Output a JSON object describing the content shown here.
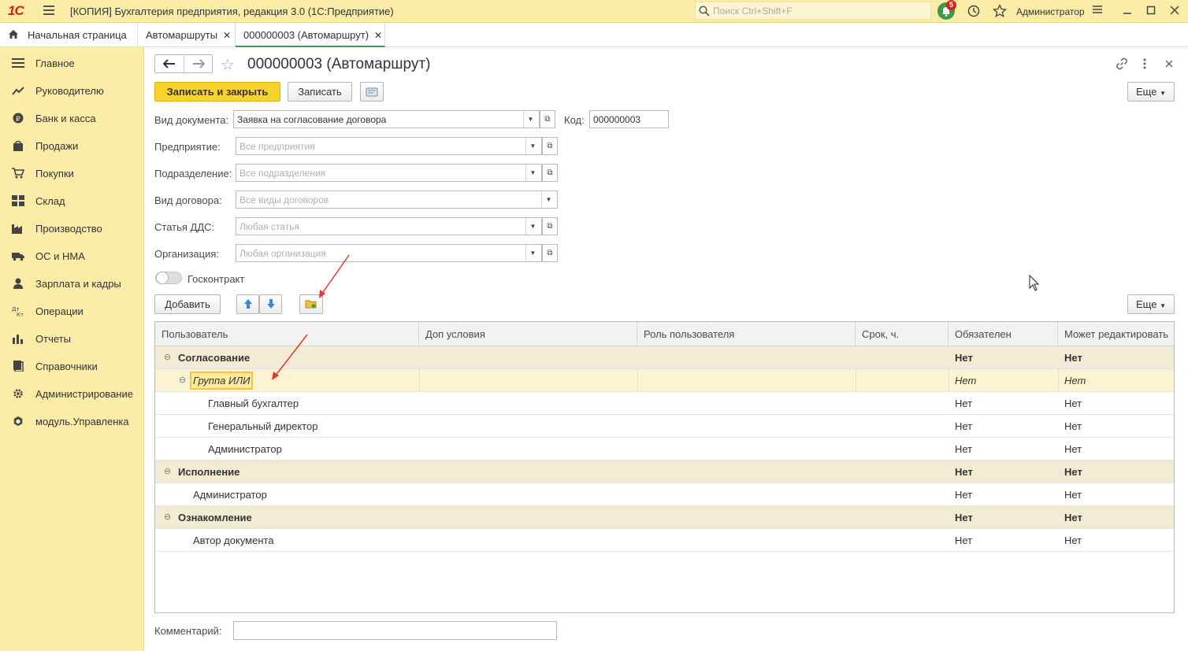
{
  "titlebar": {
    "logo": "1С",
    "app_title": "[КОПИЯ] Бухгалтерия предприятия, редакция 3.0  (1С:Предприятие)",
    "search_placeholder": "Поиск Ctrl+Shift+F",
    "notifications_count": "5",
    "user": "Администратор"
  },
  "tabs": [
    {
      "label": "Начальная страница"
    },
    {
      "label": "Автомаршруты"
    },
    {
      "label": "000000003 (Автомаршрут)"
    }
  ],
  "sidebar": {
    "items": [
      {
        "label": "Главное",
        "icon": "menu-icon"
      },
      {
        "label": "Руководителю",
        "icon": "chart-line-icon"
      },
      {
        "label": "Банк и касса",
        "icon": "coin-icon"
      },
      {
        "label": "Продажи",
        "icon": "shopping-bag-icon"
      },
      {
        "label": "Покупки",
        "icon": "cart-icon"
      },
      {
        "label": "Склад",
        "icon": "warehouse-icon"
      },
      {
        "label": "Производство",
        "icon": "factory-icon"
      },
      {
        "label": "ОС и НМА",
        "icon": "truck-icon"
      },
      {
        "label": "Зарплата и кадры",
        "icon": "person-icon"
      },
      {
        "label": "Операции",
        "icon": "dt-kt-icon"
      },
      {
        "label": "Отчеты",
        "icon": "bar-chart-icon"
      },
      {
        "label": "Справочники",
        "icon": "books-icon"
      },
      {
        "label": "Администрирование",
        "icon": "gear-icon"
      },
      {
        "label": "модуль.Управленка",
        "icon": "cube-icon"
      }
    ]
  },
  "form": {
    "title": "000000003 (Автомаршрут)",
    "save_close": "Записать и закрыть",
    "save": "Записать",
    "more": "Еще",
    "doc_type_label": "Вид документа:",
    "doc_type_value": "Заявка на согласование договора",
    "code_label": "Код:",
    "code_value": "000000003",
    "enterprise_label": "Предприятие:",
    "enterprise_placeholder": "Все предприятия",
    "department_label": "Подразделение:",
    "department_placeholder": "Все подразделения",
    "contract_type_label": "Вид договора:",
    "contract_type_placeholder": "Все виды договоров",
    "dds_label": "Статья ДДС:",
    "dds_placeholder": "Любая статья",
    "org_label": "Организация:",
    "org_placeholder": "Любая организация",
    "goscontract_label": "Госконтракт",
    "add": "Добавить",
    "more2": "Еще",
    "comment_label": "Комментарий:",
    "comment_value": ""
  },
  "table": {
    "columns": [
      "Пользователь",
      "Доп условия",
      "Роль пользователя",
      "Срок, ч.",
      "Обязателен",
      "Может редактировать"
    ],
    "rows": [
      {
        "user": "Согласование",
        "required": "Нет",
        "editable": "Нет"
      },
      {
        "user": "Группа ИЛИ",
        "required": "Нет",
        "editable": "Нет"
      },
      {
        "user": "Главный бухгалтер",
        "required": "Нет",
        "editable": "Нет"
      },
      {
        "user": "Генеральный директор",
        "required": "Нет",
        "editable": "Нет"
      },
      {
        "user": "Администратор",
        "required": "Нет",
        "editable": "Нет"
      },
      {
        "user": "Исполнение",
        "required": "Нет",
        "editable": "Нет"
      },
      {
        "user": "Администратор",
        "required": "Нет",
        "editable": "Нет"
      },
      {
        "user": "Ознакомление",
        "required": "Нет",
        "editable": "Нет"
      },
      {
        "user": "Автор документа",
        "required": "Нет",
        "editable": "Нет"
      }
    ]
  },
  "colors": {
    "panel": "#fbeda7",
    "primary_button": "#f8d32d",
    "group_row": "#f2ecd4",
    "active_tab": "#3b9e4a",
    "annotation_arrow": "#e03c2c"
  }
}
